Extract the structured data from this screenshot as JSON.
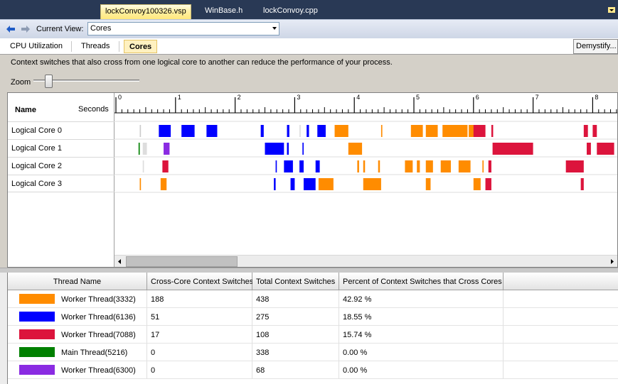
{
  "tabs": [
    {
      "label": "lockConvoy100326.vsp",
      "active": true
    },
    {
      "label": "WinBase.h",
      "active": false
    },
    {
      "label": "lockConvoy.cpp",
      "active": false
    }
  ],
  "toolbar": {
    "back_icon": "back-arrow-icon",
    "forward_icon": "forward-arrow-icon",
    "current_view_label": "Current View:",
    "current_view_value": "Cores"
  },
  "view_tabs": [
    {
      "label": "CPU Utilization",
      "selected": false
    },
    {
      "label": "Threads",
      "selected": false
    },
    {
      "label": "Cores",
      "selected": true
    }
  ],
  "demystify_label": "Demystify...",
  "info_text": "Context switches that also cross from one logical core to another can reduce the performance of your process.",
  "zoom": {
    "label": "Zoom",
    "level": 0.14
  },
  "timeline": {
    "header_name": "Name",
    "header_seconds": "Seconds",
    "ticks": [
      "0",
      "1",
      "2",
      "3",
      "4",
      "5",
      "6",
      "7",
      "8"
    ],
    "cores": [
      "Logical Core 0",
      "Logical Core 1",
      "Logical Core 2",
      "Logical Core 3"
    ]
  },
  "colors": {
    "orange": "#ff8c00",
    "blue": "#0000ff",
    "red": "#dc143c",
    "green": "#008000",
    "purple": "#8a2be2"
  },
  "activity": [
    [
      [
        0.4,
        0.42,
        "#cccccc"
      ],
      [
        0.72,
        0.92,
        "#0000ff"
      ],
      [
        1.1,
        1.32,
        "#0000ff"
      ],
      [
        1.52,
        1.7,
        "#0000ff"
      ],
      [
        2.43,
        2.48,
        "#0000ff"
      ],
      [
        2.87,
        2.91,
        "#0000ff"
      ],
      [
        3.08,
        3.1,
        "#dddddd"
      ],
      [
        3.2,
        3.24,
        "#0000ff"
      ],
      [
        3.38,
        3.52,
        "#0000ff"
      ],
      [
        3.67,
        3.9,
        "#ff8c00"
      ],
      [
        4.45,
        4.47,
        "#ff8c00"
      ],
      [
        4.95,
        5.15,
        "#ff8c00"
      ],
      [
        5.2,
        5.4,
        "#ff8c00"
      ],
      [
        5.48,
        5.9,
        "#ff8c00"
      ],
      [
        5.92,
        6.2,
        "#ff8c00"
      ],
      [
        6.0,
        6.2,
        "#dc143c"
      ],
      [
        6.3,
        6.33,
        "#dc143c"
      ],
      [
        7.85,
        7.92,
        "#dc143c"
      ],
      [
        8.0,
        8.07,
        "#dc143c"
      ]
    ],
    [
      [
        0.38,
        0.4,
        "#008000"
      ],
      [
        0.45,
        0.52,
        "#dddddd"
      ],
      [
        0.8,
        0.9,
        "#8a2be2"
      ],
      [
        2.5,
        2.82,
        "#0000ff"
      ],
      [
        2.87,
        2.9,
        "#0000ff"
      ],
      [
        3.13,
        3.15,
        "#0000ff"
      ],
      [
        3.9,
        4.13,
        "#ff8c00"
      ],
      [
        6.32,
        7.0,
        "#dc143c"
      ],
      [
        7.9,
        7.97,
        "#dc143c"
      ],
      [
        8.07,
        8.36,
        "#dc143c"
      ]
    ],
    [
      [
        0.45,
        0.47,
        "#dddddd"
      ],
      [
        0.78,
        0.88,
        "#dc143c"
      ],
      [
        2.68,
        2.7,
        "#0000ff"
      ],
      [
        2.82,
        2.97,
        "#0000ff"
      ],
      [
        3.08,
        3.15,
        "#0000ff"
      ],
      [
        3.35,
        3.42,
        "#0000ff"
      ],
      [
        4.05,
        4.08,
        "#ff8c00"
      ],
      [
        4.15,
        4.18,
        "#ff8c00"
      ],
      [
        4.4,
        4.43,
        "#ff8c00"
      ],
      [
        4.85,
        4.98,
        "#ff8c00"
      ],
      [
        5.05,
        5.1,
        "#ff8c00"
      ],
      [
        5.2,
        5.32,
        "#ff8c00"
      ],
      [
        5.45,
        5.62,
        "#ff8c00"
      ],
      [
        5.75,
        5.95,
        "#ff8c00"
      ],
      [
        6.15,
        6.17,
        "#ff8c00"
      ],
      [
        6.25,
        6.3,
        "#dc143c"
      ],
      [
        7.55,
        7.85,
        "#dc143c"
      ]
    ],
    [
      [
        0.4,
        0.42,
        "#ff8c00"
      ],
      [
        0.75,
        0.85,
        "#ff8c00"
      ],
      [
        2.65,
        2.68,
        "#0000ff"
      ],
      [
        2.93,
        3.0,
        "#0000ff"
      ],
      [
        3.15,
        3.35,
        "#0000ff"
      ],
      [
        3.4,
        3.65,
        "#ff8c00"
      ],
      [
        4.15,
        4.45,
        "#ff8c00"
      ],
      [
        5.2,
        5.28,
        "#ff8c00"
      ],
      [
        6.0,
        6.12,
        "#ff8c00"
      ],
      [
        6.2,
        6.3,
        "#dc143c"
      ],
      [
        7.8,
        7.85,
        "#dc143c"
      ]
    ]
  ],
  "table": {
    "headers": [
      "Thread Name",
      "Cross-Core Context Switches",
      "Total Context Switches",
      "Percent of Context Switches that Cross Cores"
    ],
    "rows": [
      {
        "color": "#ff8c00",
        "name": "Worker Thread(3332)",
        "cross": "188",
        "total": "438",
        "percent": "42.92 %"
      },
      {
        "color": "#0000ff",
        "name": "Worker Thread(6136)",
        "cross": "51",
        "total": "275",
        "percent": "18.55 %"
      },
      {
        "color": "#dc143c",
        "name": "Worker Thread(7088)",
        "cross": "17",
        "total": "108",
        "percent": "15.74 %"
      },
      {
        "color": "#008000",
        "name": "Main Thread(5216)",
        "cross": "0",
        "total": "338",
        "percent": "0.00 %"
      },
      {
        "color": "#8a2be2",
        "name": "Worker Thread(6300)",
        "cross": "0",
        "total": "68",
        "percent": "0.00 %"
      }
    ]
  }
}
